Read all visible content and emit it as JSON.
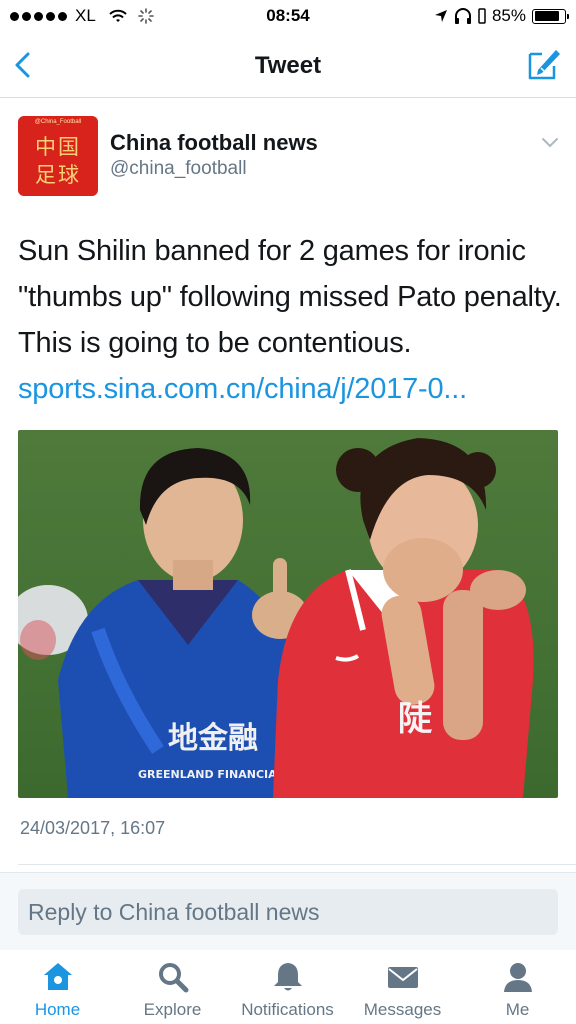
{
  "status_bar": {
    "carrier": "XL",
    "time": "08:54",
    "battery": "85%",
    "battery_level": 0.85
  },
  "nav": {
    "title": "Tweet",
    "back_icon": "chevron-left-icon",
    "compose_icon": "compose-icon"
  },
  "tweet": {
    "avatar": {
      "small_text": "@China_Football",
      "line1": "中国",
      "line2": "足球"
    },
    "display_name": "China football news",
    "handle": "@china_football",
    "text": "Sun Shilin banned for 2 games for ironic \"thumbs up\" following missed Pato penalty. This is going to be contentious.",
    "link": "sports.sina.com.cn/china/j/2017-0...",
    "photo": {
      "shirt_text_left": "地金融",
      "shirt_text_left2": "GREENLAND FINANCIAL",
      "shirt_text_right": "陡"
    },
    "timestamp": "24/03/2017, 16:07"
  },
  "reply": {
    "placeholder": "Reply to China football news"
  },
  "tabs": [
    {
      "label": "Home",
      "icon": "home-icon",
      "active": true
    },
    {
      "label": "Explore",
      "icon": "search-icon",
      "active": false
    },
    {
      "label": "Notifications",
      "icon": "bell-icon",
      "active": false
    },
    {
      "label": "Messages",
      "icon": "envelope-icon",
      "active": false
    },
    {
      "label": "Me",
      "icon": "person-icon",
      "active": false
    }
  ],
  "colors": {
    "accent": "#1b95e0",
    "text": "#14171a",
    "muted": "#657786",
    "avatar_bg": "#d8221c"
  }
}
